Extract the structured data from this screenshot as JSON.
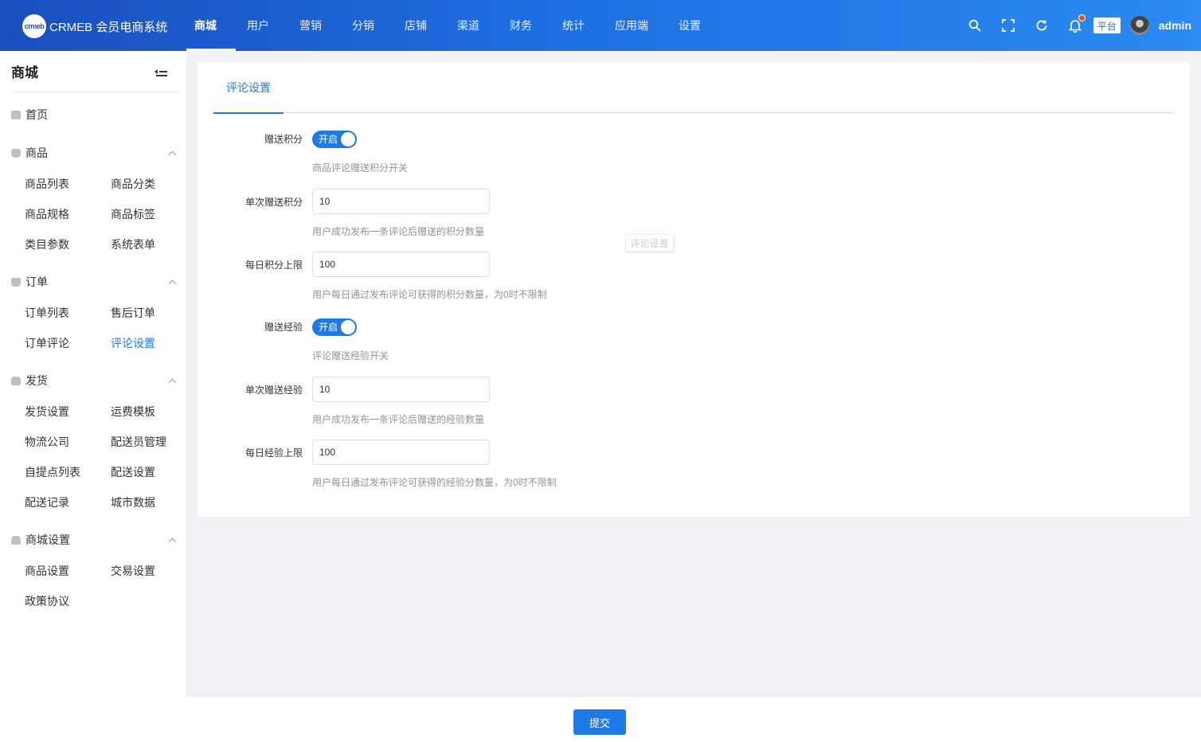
{
  "header": {
    "logo_badge": "crmeb",
    "brand": "CRMEB 会员电商系统",
    "nav": [
      {
        "label": "商城",
        "active": true
      },
      {
        "label": "用户"
      },
      {
        "label": "营销"
      },
      {
        "label": "分销"
      },
      {
        "label": "店铺"
      },
      {
        "label": "渠道"
      },
      {
        "label": "财务"
      },
      {
        "label": "统计"
      },
      {
        "label": "应用端"
      },
      {
        "label": "设置"
      }
    ],
    "platform_tag": "平台",
    "username": "admin",
    "icons": [
      "search-icon",
      "fullscreen-icon",
      "refresh-icon",
      "bell-icon"
    ]
  },
  "sidebar": {
    "title": "商城",
    "home": "首页",
    "groups": [
      {
        "label": "商品",
        "icon": "bag-icon",
        "items": [
          "商品列表",
          "商品分类",
          "商品规格",
          "商品标签",
          "类目参数",
          "系统表单"
        ]
      },
      {
        "label": "订单",
        "icon": "cart-icon",
        "items": [
          "订单列表",
          "售后订单",
          "订单评论",
          "评论设置"
        ]
      },
      {
        "label": "发货",
        "icon": "box-icon",
        "items": [
          "发货设置",
          "运费模板",
          "物流公司",
          "配送员管理",
          "自提点列表",
          "配送设置",
          "配送记录",
          "城市数据"
        ]
      },
      {
        "label": "商城设置",
        "icon": "store-icon",
        "items": [
          "商品设置",
          "交易设置",
          "政策协议"
        ]
      }
    ],
    "active_item": "评论设置"
  },
  "main": {
    "tab": "评论设置",
    "drag_ghost": "评论设置",
    "fields": {
      "give_points": {
        "label": "赠送积分",
        "switch_text": "开启",
        "on": true,
        "hint": "商品评论赠送积分开关"
      },
      "points_per": {
        "label": "单次赠送积分",
        "value": "10",
        "hint": "用户成功发布一条评论后赠送的积分数量"
      },
      "points_daily": {
        "label": "每日积分上限",
        "value": "100",
        "hint": "用户每日通过发布评论可获得的积分数量，为0时不限制"
      },
      "give_exp": {
        "label": "赠送经验",
        "switch_text": "开启",
        "on": true,
        "hint": "评论赠送经验开关"
      },
      "exp_per": {
        "label": "单次赠送经验",
        "value": "10",
        "hint": "用户成功发布一条评论后赠送的经验数量"
      },
      "exp_daily": {
        "label": "每日经验上限",
        "value": "100",
        "hint": "用户每日通过发布评论可获得的经验分数量，为0时不限制"
      }
    }
  },
  "footer": {
    "submit": "提交"
  },
  "colors": {
    "primary": "#1e7ae6",
    "header_start": "#1a4fbf",
    "header_end": "#2a8bf2",
    "notify_dot": "#ff4d1a"
  }
}
